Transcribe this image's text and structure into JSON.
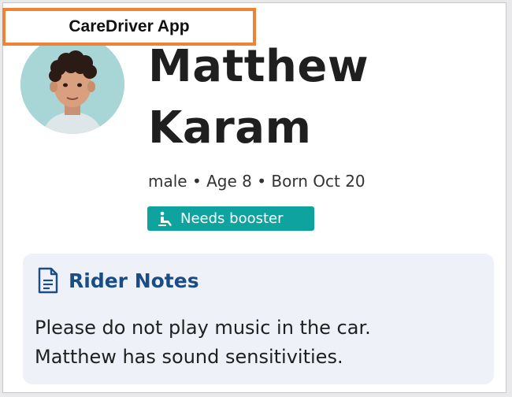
{
  "app": {
    "title": "CareDriver App"
  },
  "rider": {
    "first_name": "Matthew",
    "last_name": "Karam",
    "gender": "male",
    "age": "Age 8",
    "born": "Born Oct 20",
    "separator": "•"
  },
  "badge": {
    "icon": "car-seat-icon",
    "label": "Needs booster",
    "color": "#0fa3a0"
  },
  "notes": {
    "icon": "document-icon",
    "title": "Rider Notes",
    "lines": [
      "Please do not play music in the car.",
      "Matthew has sound sensitivities."
    ]
  },
  "colors": {
    "accent_orange": "#ee8338",
    "notes_title": "#1b4d84",
    "notes_bg": "#eef2f8"
  }
}
